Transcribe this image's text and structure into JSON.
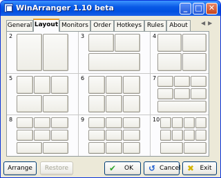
{
  "window": {
    "title": "WinArranger 1.10 beta"
  },
  "title_buttons": {
    "minimize": "_",
    "maximize": "□",
    "close": "✕"
  },
  "tabs": [
    {
      "label": "General",
      "active": false
    },
    {
      "label": "Layout",
      "active": true
    },
    {
      "label": "Monitors",
      "active": false
    },
    {
      "label": "Order",
      "active": false
    },
    {
      "label": "Hotkeys",
      "active": false
    },
    {
      "label": "Rules",
      "active": false
    },
    {
      "label": "About",
      "active": false
    }
  ],
  "tab_scroll": {
    "left": "◀",
    "right": "▶"
  },
  "layouts": [
    {
      "number": "2"
    },
    {
      "number": "3"
    },
    {
      "number": "4"
    },
    {
      "number": "5"
    },
    {
      "number": "6"
    },
    {
      "number": "7"
    },
    {
      "number": "8"
    },
    {
      "number": "9"
    },
    {
      "number": "10"
    }
  ],
  "buttons": {
    "arrange": "Arrange",
    "restore": "Restore",
    "ok": "OK",
    "cancel": "Cancel",
    "exit": "Exit"
  },
  "colors": {
    "ok_icon": "#2fa52f",
    "cancel_icon": "#1f5fd0",
    "exit_icon": "#d4b400",
    "active_tab_accent": "#e69d2b"
  }
}
